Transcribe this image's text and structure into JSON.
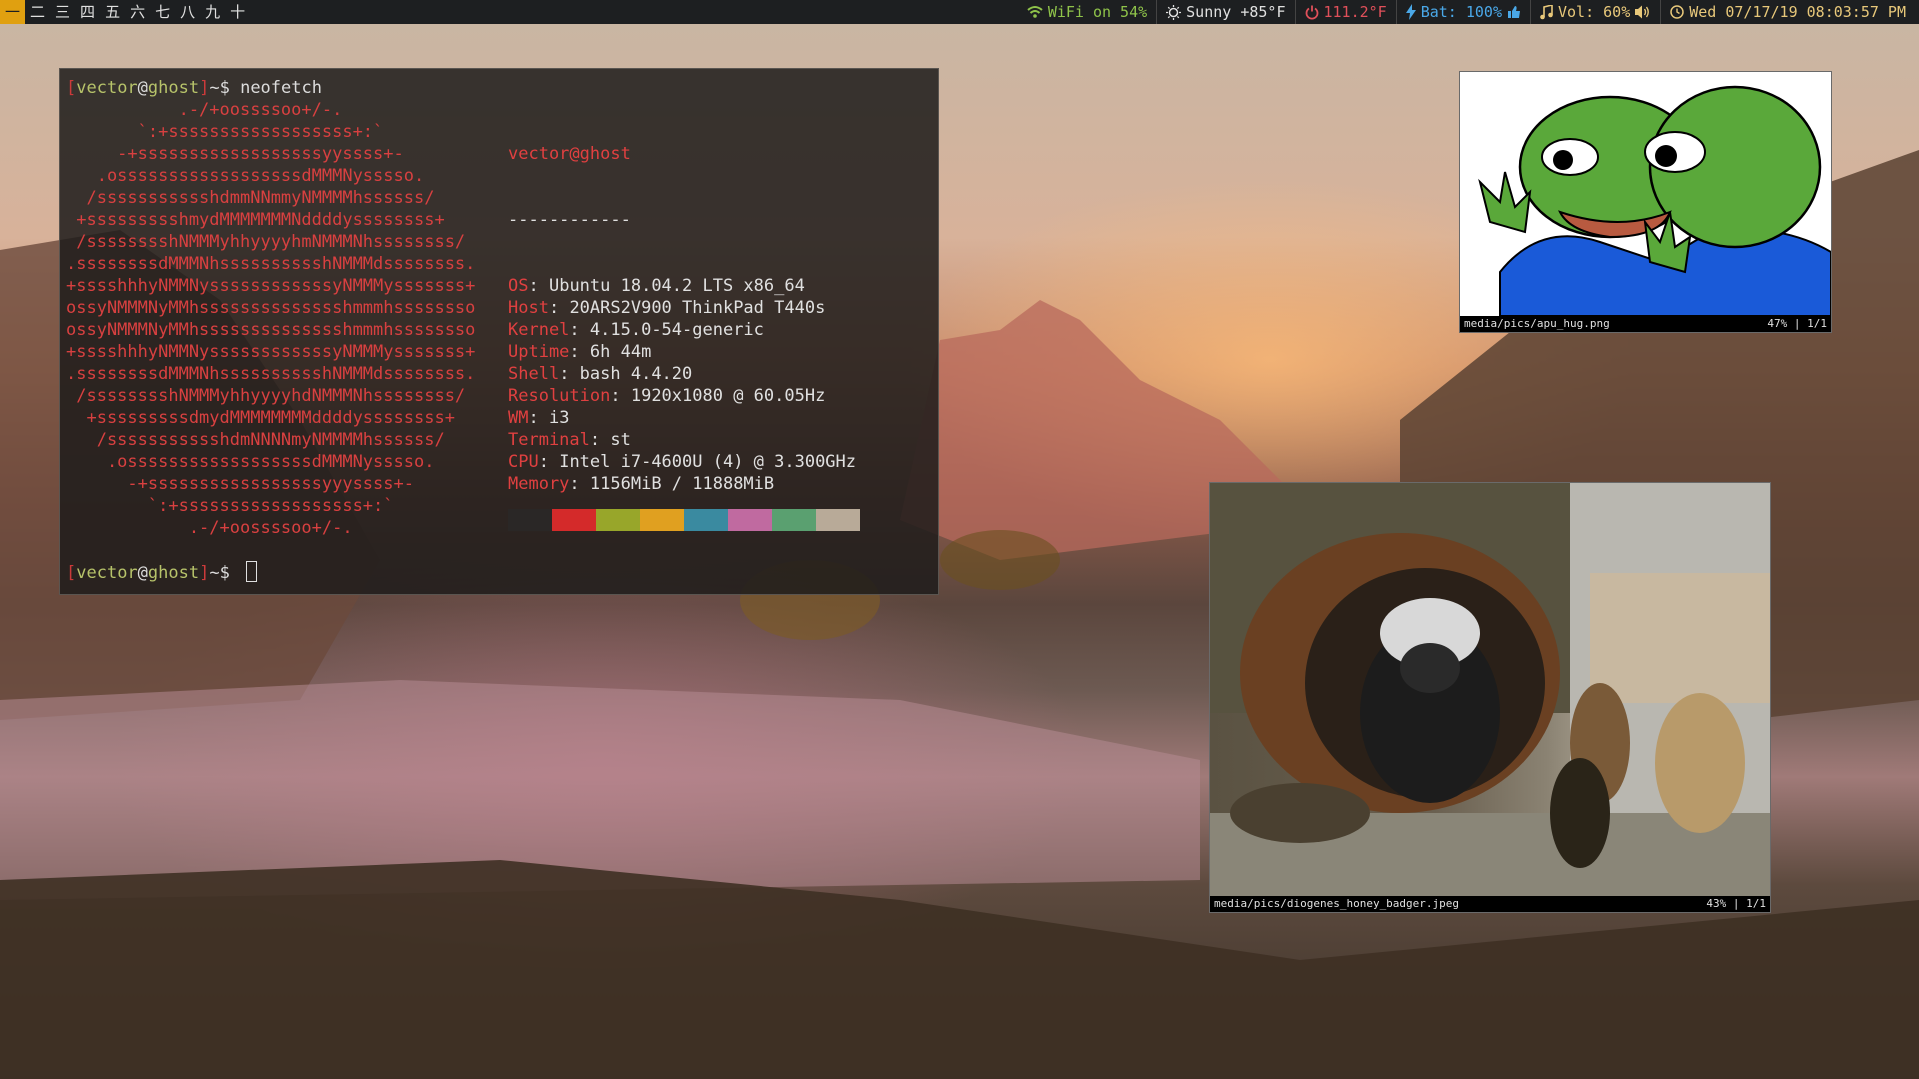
{
  "workspaces": [
    {
      "label": "一",
      "active": true
    },
    {
      "label": "二",
      "active": false
    },
    {
      "label": "三",
      "active": false
    },
    {
      "label": "四",
      "active": false
    },
    {
      "label": "五",
      "active": false
    },
    {
      "label": "六",
      "active": false
    },
    {
      "label": "七",
      "active": false
    },
    {
      "label": "八",
      "active": false
    },
    {
      "label": "九",
      "active": false
    },
    {
      "label": "十",
      "active": false
    }
  ],
  "status": {
    "wifi": "WiFi on 54%",
    "weather": "Sunny +85°F",
    "temp": "111.2°F",
    "battery": "Bat: 100%",
    "volume": "Vol: 60%",
    "datetime": "Wed 07/17/19 08:03:57 PM"
  },
  "colors": {
    "wifi": "#8fc34a",
    "weather": "#e0e0e0",
    "temp": "#e0505a",
    "battery": "#4aa8e8",
    "volume": "#e8c87a",
    "datetime": "#e8c87a"
  },
  "terminal": {
    "prompt": {
      "open": "[",
      "user": "vector",
      "at": "@",
      "host": "ghost",
      "close": "]",
      "sym": "~$ "
    },
    "command": "neofetch",
    "logo_lines": [
      "           .-/+oossssoo+/-.",
      "       `:+ssssssssssssssssss+:`",
      "     -+ssssssssssssssssssyyssss+-",
      "   .ossssssssssssssssssdMMMNysssso.",
      "  /ssssssssssshdmmNNmmyNMMMMhssssss/",
      " +ssssssssshmydMMMMMMMNddddyssssssss+",
      " /sssssssshNMMMyhhyyyyhmNMMMNhssssssss/",
      ".ssssssssdMMMNhsssssssssshNMMMdssssssss.",
      "+sssshhhyNMMNyssssssssssssyNMMMysssssss+",
      "ossyNMMMNyMMhsssssssssssssshmmmhssssssso",
      "ossyNMMMNyMMhsssssssssssssshmmmhssssssso",
      "+sssshhhyNMMNyssssssssssssyNMMMysssssss+",
      ".ssssssssdMMMNhsssssssssshNMMMdssssssss.",
      " /sssssssshNMMMyhhyyyyhdNMMMNhssssssss/",
      "  +sssssssssdmydMMMMMMMMddddyssssssss+",
      "   /ssssssssssshdmNNNNmyNMMMMhssssss/",
      "    .ossssssssssssssssssdMMMNysssso.",
      "      -+sssssssssssssssssyyyssss+-",
      "        `:+ssssssssssssssssss+:`",
      "            .-/+oossssoo+/-."
    ],
    "info_title": "vector@ghost",
    "info_sep": "------------",
    "info": [
      {
        "key": "OS",
        "value": "Ubuntu 18.04.2 LTS x86_64"
      },
      {
        "key": "Host",
        "value": "20ARS2V900 ThinkPad T440s"
      },
      {
        "key": "Kernel",
        "value": "4.15.0-54-generic"
      },
      {
        "key": "Uptime",
        "value": "6h 44m"
      },
      {
        "key": "Shell",
        "value": "bash 4.4.20"
      },
      {
        "key": "Resolution",
        "value": "1920x1080 @ 60.05Hz"
      },
      {
        "key": "WM",
        "value": "i3"
      },
      {
        "key": "Terminal",
        "value": "st"
      },
      {
        "key": "CPU",
        "value": "Intel i7-4600U (4) @ 3.300GHz"
      },
      {
        "key": "Memory",
        "value": "1156MiB / 11888MiB"
      }
    ],
    "swatches": [
      "#2a2726",
      "#d42a2a",
      "#98a62a",
      "#e0a020",
      "#3a8aa0",
      "#c06aa0",
      "#5aa070",
      "#b8aa98"
    ]
  },
  "viewer1": {
    "path": "media/pics/apu_hug.png",
    "info": "47% | 1/1"
  },
  "viewer2": {
    "path": "media/pics/diogenes_honey_badger.jpeg",
    "info": "43% | 1/1"
  }
}
